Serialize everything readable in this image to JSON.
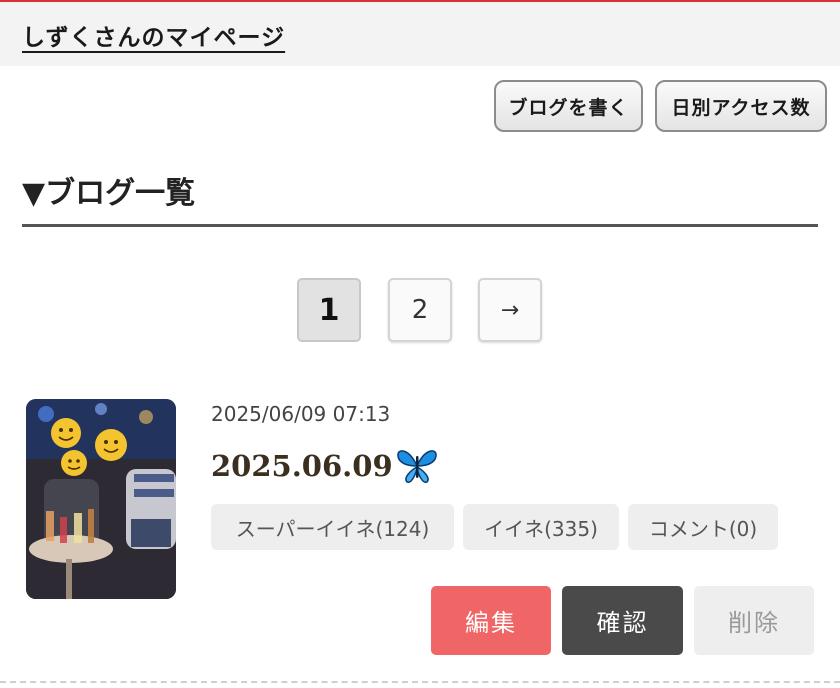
{
  "header": {
    "title": "しずくさんのマイページ"
  },
  "toolbar": {
    "write_label": "ブログを書く",
    "access_label": "日別アクセス数"
  },
  "section": {
    "heading": "▼ブログ一覧"
  },
  "pagination": {
    "pages": [
      "1",
      "2"
    ],
    "next_label": "→",
    "current": "1"
  },
  "post": {
    "date": "2025/06/09 07:13",
    "title": "2025.06.09",
    "title_icon": "butterfly-emoji",
    "stats": {
      "super_like": "スーパーイイネ(124)",
      "like": "イイネ(335)",
      "comment": "コメント(0)"
    },
    "actions": {
      "edit": "編集",
      "confirm": "確認",
      "delete": "削除"
    }
  },
  "colors": {
    "accent_red": "#d9313b",
    "edit_button": "#f06565",
    "confirm_button": "#4a4a4a",
    "delete_button": "#eeeeee"
  }
}
